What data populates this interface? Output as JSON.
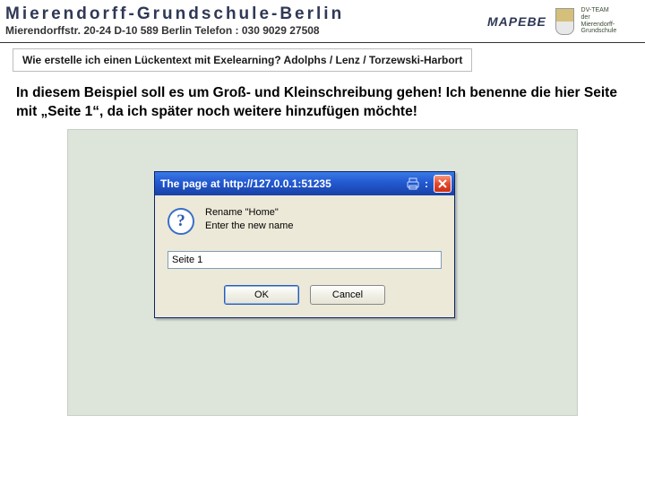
{
  "header": {
    "school_name": "Mierendorff-Grundschule-Berlin",
    "address_line": "Mierendorffstr. 20-24 D-10 589 Berlin  Telefon : 030 9029 27508",
    "mapebe": "MAPEBE",
    "dv_team_line1": "DV-TEAM",
    "dv_team_line2": "der",
    "dv_team_line3": "Mierendorff-Grundschule"
  },
  "subheader": "Wie erstelle ich einen Lückentext mit Exelearning? Adolphs /  Lenz / Torzewski-Harbort",
  "main_text": "In diesem Beispiel soll es um Groß- und Kleinschreibung gehen! Ich benenne die  hier Seite mit „Seite 1“, da ich später noch weitere hinzufügen möchte!",
  "dialog": {
    "title_prefix": "The page at http://127.0.0.1:51235",
    "prompt_line1": "Rename \"Home\"",
    "prompt_line2": "Enter the new name",
    "input_value": "Seite 1",
    "ok_label": "OK",
    "cancel_label": "Cancel"
  },
  "icons": {
    "question_glyph": "?"
  }
}
